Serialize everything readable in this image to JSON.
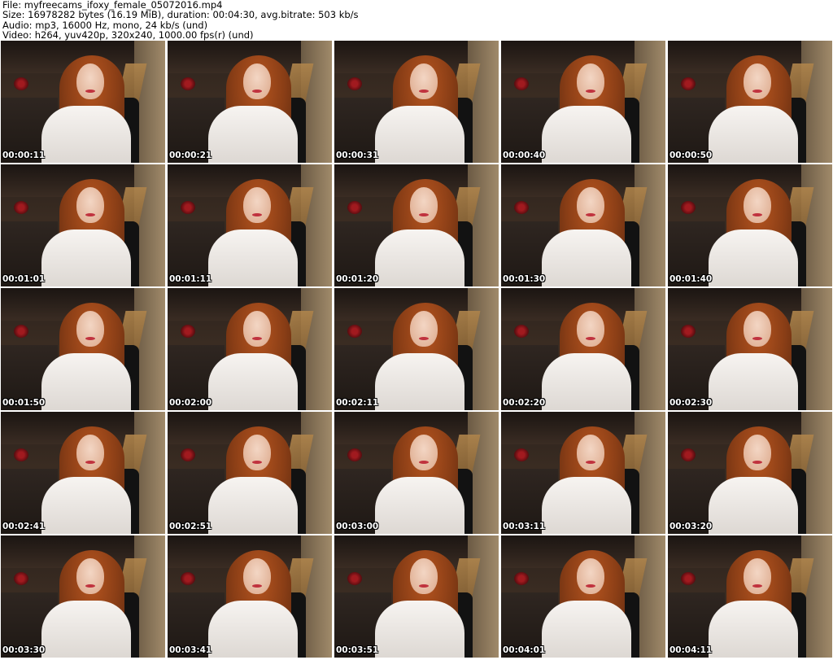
{
  "header": {
    "file": "File: myfreecams_ifoxy_female_05072016.mp4",
    "size": "Size: 16978282 bytes (16.19 MiB), duration: 00:04:30, avg.bitrate: 503 kb/s",
    "audio": "Audio: mp3, 16000 Hz, mono, 24 kb/s (und)",
    "video": "Video: h264, yuv420p, 320x240, 1000.00 fps(r) (und)"
  },
  "thumbnails": [
    {
      "timestamp": "00:00:11"
    },
    {
      "timestamp": "00:00:21"
    },
    {
      "timestamp": "00:00:31"
    },
    {
      "timestamp": "00:00:40"
    },
    {
      "timestamp": "00:00:50"
    },
    {
      "timestamp": "00:01:01"
    },
    {
      "timestamp": "00:01:11"
    },
    {
      "timestamp": "00:01:20"
    },
    {
      "timestamp": "00:01:30"
    },
    {
      "timestamp": "00:01:40"
    },
    {
      "timestamp": "00:01:50"
    },
    {
      "timestamp": "00:02:00"
    },
    {
      "timestamp": "00:02:11"
    },
    {
      "timestamp": "00:02:20"
    },
    {
      "timestamp": "00:02:30"
    },
    {
      "timestamp": "00:02:41"
    },
    {
      "timestamp": "00:02:51"
    },
    {
      "timestamp": "00:03:00"
    },
    {
      "timestamp": "00:03:11"
    },
    {
      "timestamp": "00:03:20"
    },
    {
      "timestamp": "00:03:30"
    },
    {
      "timestamp": "00:03:41"
    },
    {
      "timestamp": "00:03:51"
    },
    {
      "timestamp": "00:04:01"
    },
    {
      "timestamp": "00:04:11"
    }
  ]
}
